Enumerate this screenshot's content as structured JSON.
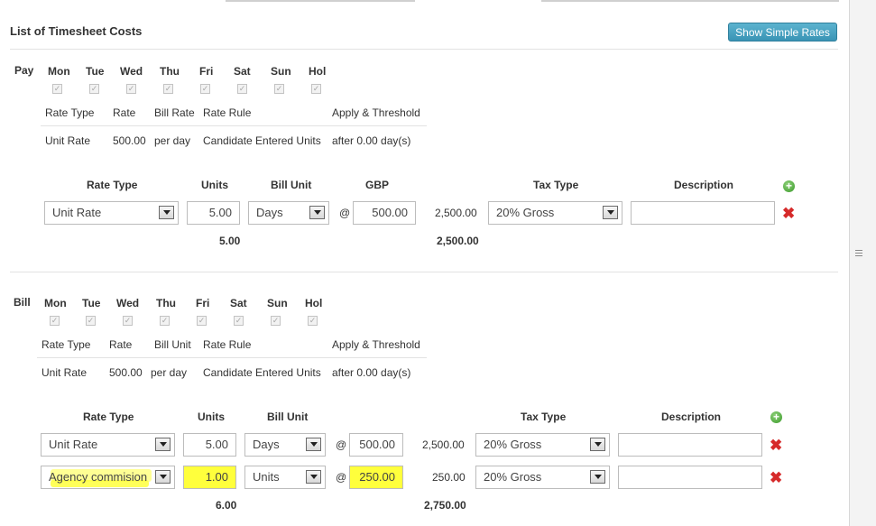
{
  "page": {
    "title": "List of Timesheet Costs",
    "show_button": "Show Simple Rates"
  },
  "days": [
    "Mon",
    "Tue",
    "Wed",
    "Thu",
    "Fri",
    "Sat",
    "Sun",
    "Hol"
  ],
  "summary_headers": {
    "rate_type": "Rate Type",
    "rate": "Rate",
    "rule": "Rate Rule",
    "apply": "Apply & Threshold"
  },
  "lines_headers": {
    "rate_type": "Rate Type",
    "units": "Units",
    "bill_unit": "Bill Unit",
    "tax_type": "Tax Type",
    "description": "Description",
    "at": "@"
  },
  "pay": {
    "label": "Pay",
    "bill_col_header": "Bill Rate",
    "summary": {
      "rate_type": "Unit Rate",
      "rate": "500.00",
      "per": "per day",
      "rule": "Candidate Entered Units",
      "threshold": "after 0.00 day(s)"
    },
    "currency_header": "GBP",
    "lines": [
      {
        "rate_type": "Unit Rate",
        "units": "5.00",
        "bill_unit": "Days",
        "rate": "500.00",
        "amount": "2,500.00",
        "tax_type": "20% Gross",
        "description": ""
      }
    ],
    "total_units": "5.00",
    "total_amount": "2,500.00"
  },
  "bill": {
    "label": "Bill",
    "bill_col_header": "Bill Unit",
    "summary": {
      "rate_type": "Unit Rate",
      "rate": "500.00",
      "per": "per day",
      "rule": "Candidate Entered Units",
      "threshold": "after 0.00 day(s)"
    },
    "lines": [
      {
        "rate_type": "Unit Rate",
        "units": "5.00",
        "bill_unit": "Days",
        "rate": "500.00",
        "amount": "2,500.00",
        "tax_type": "20% Gross",
        "description": ""
      },
      {
        "rate_type": "Agency commision",
        "units": "1.00",
        "bill_unit": "Units",
        "rate": "250.00",
        "amount": "250.00",
        "tax_type": "20% Gross",
        "description": ""
      }
    ],
    "total_units": "6.00",
    "total_amount": "2,750.00"
  },
  "icons": {
    "add": "add-circle-icon",
    "delete": "delete-x-icon",
    "checkbox": "check-icon",
    "dropdown": "chevron-down-icon"
  },
  "colors": {
    "button": "#3a94b5",
    "highlight": "#ffff3c",
    "delete": "#d62a2a",
    "add": "#3a9a2a"
  }
}
